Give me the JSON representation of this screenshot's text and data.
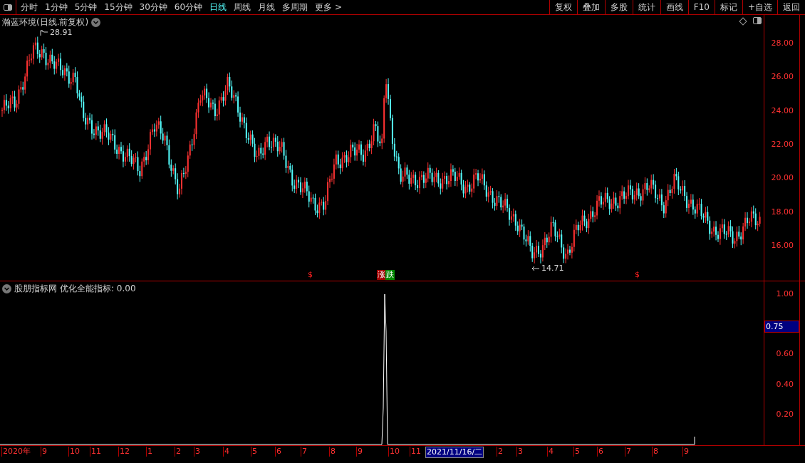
{
  "toolbar": {
    "periods": [
      {
        "label": "分时",
        "selected": false
      },
      {
        "label": "1分钟",
        "selected": false
      },
      {
        "label": "5分钟",
        "selected": false
      },
      {
        "label": "15分钟",
        "selected": false
      },
      {
        "label": "30分钟",
        "selected": false
      },
      {
        "label": "60分钟",
        "selected": false
      },
      {
        "label": "日线",
        "selected": true
      },
      {
        "label": "周线",
        "selected": false
      },
      {
        "label": "月线",
        "selected": false
      },
      {
        "label": "多周期",
        "selected": false
      },
      {
        "label": "更多 >",
        "selected": false
      }
    ],
    "buttons": [
      "复权",
      "叠加",
      "多股",
      "统计",
      "画线",
      "F10",
      "标记",
      "+自选",
      "返回"
    ]
  },
  "main_chart": {
    "title": "瀚蓝环境(日线.前复权)",
    "high_label": "28.91",
    "low_label": "14.71",
    "yticks": [
      "28.00",
      "26.00",
      "24.00",
      "22.00",
      "20.00",
      "18.00",
      "16.00"
    ],
    "signals": [
      {
        "kind": "dollar",
        "label": "$"
      },
      {
        "kind": "rise",
        "label": "涨"
      },
      {
        "kind": "fall",
        "label": "跌"
      },
      {
        "kind": "dollar",
        "label": "$"
      }
    ]
  },
  "indicator": {
    "title": "股朋指标网",
    "formula": "优化全能指标: 0.00",
    "yticks": [
      "1.00",
      "0.60",
      "0.40",
      "0.20"
    ],
    "cursor_value": "0.75"
  },
  "date_axis": [
    {
      "label": "2020年",
      "selected": false
    },
    {
      "label": "9",
      "selected": false
    },
    {
      "label": "10",
      "selected": false
    },
    {
      "label": "11",
      "selected": false
    },
    {
      "label": "12",
      "selected": false
    },
    {
      "label": "1",
      "selected": false
    },
    {
      "label": "2",
      "selected": false
    },
    {
      "label": "3",
      "selected": false
    },
    {
      "label": "4",
      "selected": false
    },
    {
      "label": "5",
      "selected": false
    },
    {
      "label": "6",
      "selected": false
    },
    {
      "label": "7",
      "selected": false
    },
    {
      "label": "8",
      "selected": false
    },
    {
      "label": "9",
      "selected": false
    },
    {
      "label": "10",
      "selected": false
    },
    {
      "label": "11",
      "selected": false
    },
    {
      "label": "2021/11/16/二",
      "selected": true
    },
    {
      "label": "2",
      "selected": false
    },
    {
      "label": "3",
      "selected": false
    },
    {
      "label": "4",
      "selected": false
    },
    {
      "label": "5",
      "selected": false
    },
    {
      "label": "6",
      "selected": false
    },
    {
      "label": "7",
      "selected": false
    },
    {
      "label": "8",
      "selected": false
    },
    {
      "label": "9",
      "selected": false
    }
  ]
}
